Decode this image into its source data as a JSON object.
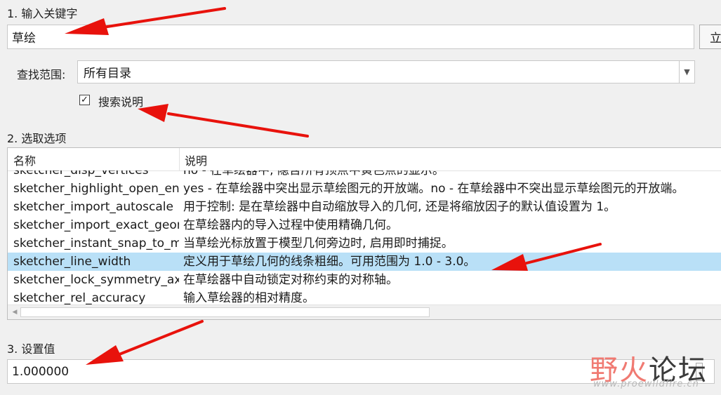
{
  "step1": {
    "label": "1. 输入关键字",
    "keyword_value": "草绘",
    "search_button_label": "立"
  },
  "scope": {
    "label": "查找范围:",
    "selected": "所有目录"
  },
  "search_desc": {
    "label": "搜索说明",
    "checked": true,
    "check_glyph": "✓"
  },
  "step2": {
    "label": "2. 选取选项",
    "columns": {
      "name": "名称",
      "desc": "说明"
    },
    "rows": [
      {
        "name": "sketcher_disp_vertices",
        "desc": "no - 在草绘器中, 隐含所有顶点中黄色点的显示。"
      },
      {
        "name": "sketcher_highlight_open_ends",
        "desc": "yes - 在草绘器中突出显示草绘图元的开放端。no - 在草绘器中不突出显示草绘图元的开放端。"
      },
      {
        "name": "sketcher_import_autoscale",
        "desc": "用于控制: 是在草绘器中自动缩放导入的几何, 还是将缩放因子的默认值设置为 1。"
      },
      {
        "name": "sketcher_import_exact_geom",
        "desc": "在草绘器内的导入过程中使用精确几何。"
      },
      {
        "name": "sketcher_instant_snap_to_model",
        "desc": "当草绘光标放置于模型几何旁边时, 启用即时捕捉。"
      },
      {
        "name": "sketcher_line_width",
        "desc": "定义用于草绘几何的线条粗细。可用范围为 1.0 - 3.0。",
        "selected": true
      },
      {
        "name": "sketcher_lock_symmetry_axis",
        "desc": "在草绘器中自动锁定对称约束的对称轴。"
      },
      {
        "name": "sketcher_rel_accuracy",
        "desc": "输入草绘器的相对精度。"
      }
    ]
  },
  "step3": {
    "label": "3. 设置值",
    "value": "1.000000"
  },
  "watermark": {
    "wild": "野火",
    "forum": "论坛",
    "url": "www.proewildfire.cn"
  },
  "colors": {
    "annotation_arrow": "#e8120c",
    "selection": "#b9e0f7"
  },
  "icons": {
    "dropdown": "chevron-down-icon",
    "scroll_left": "scroll-left-arrow-icon"
  }
}
